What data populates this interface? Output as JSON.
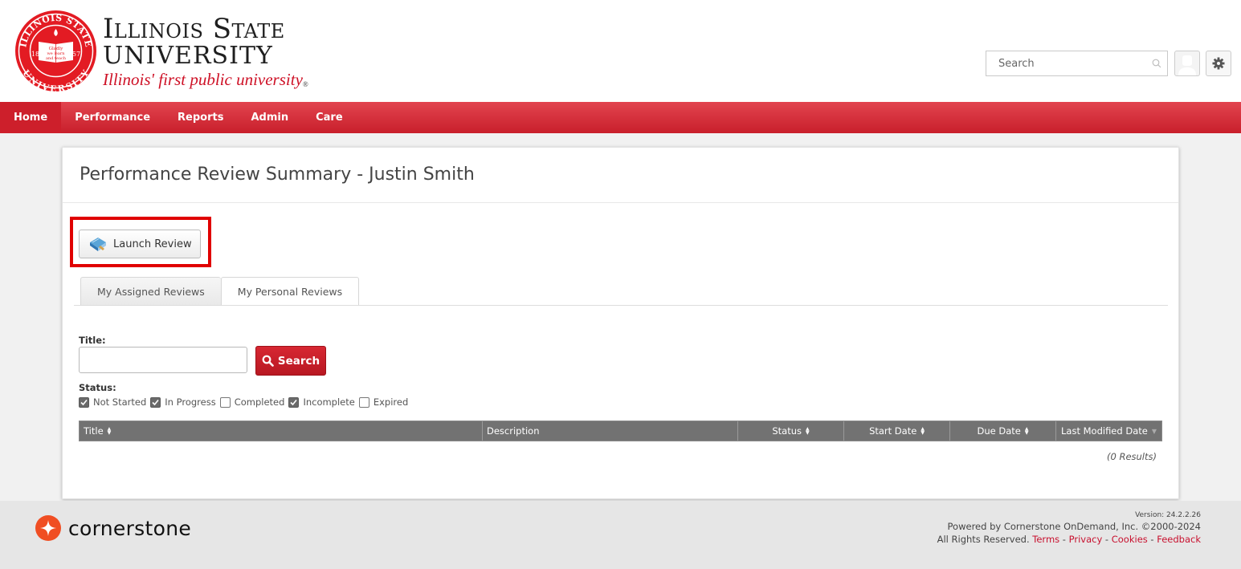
{
  "brand": {
    "seal": {
      "ring_top": "ILLINOIS STATE",
      "ring_bottom": "UNIVERSITY",
      "book_text": [
        "Gladly",
        "we learn",
        "and teach"
      ],
      "year_left": "18",
      "year_right": "57"
    },
    "name_line1": "Illinois State",
    "name_line2": "UNIVERSITY",
    "tagline": "Illinois' first public university",
    "registered_mark": "®",
    "colors": {
      "primary_red": "#ce1126",
      "nav_red": "#d42a35"
    }
  },
  "header": {
    "search_placeholder": "Search",
    "search_icon": "magnifier-icon",
    "avatar_icon": "user-avatar-icon",
    "settings_icon": "gear-icon"
  },
  "nav": {
    "items": [
      {
        "label": "Home",
        "active": true
      },
      {
        "label": "Performance",
        "active": false
      },
      {
        "label": "Reports",
        "active": false
      },
      {
        "label": "Admin",
        "active": false
      },
      {
        "label": "Care",
        "active": false
      }
    ]
  },
  "main": {
    "page_title": "Performance Review Summary - Justin Smith",
    "launch_button": {
      "label": "Launch Review",
      "icon": "book-icon"
    },
    "tabs": [
      {
        "label": "My Assigned Reviews",
        "active": true
      },
      {
        "label": "My Personal Reviews",
        "active": false
      }
    ],
    "filters": {
      "title_label": "Title:",
      "title_value": "",
      "search_button": "Search",
      "status_label": "Status:",
      "statuses": [
        {
          "label": "Not Started",
          "checked": true
        },
        {
          "label": "In Progress",
          "checked": true
        },
        {
          "label": "Completed",
          "checked": false
        },
        {
          "label": "Incomplete",
          "checked": true
        },
        {
          "label": "Expired",
          "checked": false
        }
      ]
    },
    "table": {
      "columns": [
        {
          "label": "Title",
          "sort": "both"
        },
        {
          "label": "Description",
          "sort": "none"
        },
        {
          "label": "Status",
          "sort": "both"
        },
        {
          "label": "Start Date",
          "sort": "both"
        },
        {
          "label": "Due Date",
          "sort": "both"
        },
        {
          "label": "Last Modified Date",
          "sort": "desc"
        }
      ],
      "rows": [],
      "results_text": "(0 Results)"
    }
  },
  "footer": {
    "logo_text": "cornerstone",
    "logo_color": "#f04e23",
    "version": "Version: 24.2.2.26",
    "powered_by": "Powered by Cornerstone OnDemand, Inc. ©2000-2024",
    "rights": "All Rights Reserved.",
    "links": [
      "Terms",
      "Privacy",
      "Cookies",
      "Feedback"
    ],
    "separator": " - "
  }
}
